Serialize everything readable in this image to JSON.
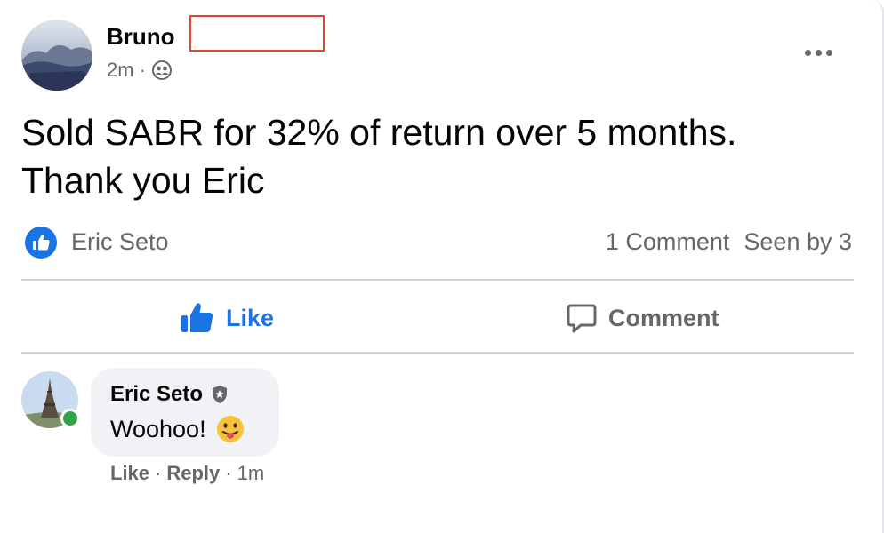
{
  "post": {
    "author": "Bruno",
    "time": "2m",
    "separator": "·",
    "audience_icon": "friends-icon",
    "more_icon": "more-options-icon",
    "text_line1": "Sold SABR for 32% of return over 5 months.",
    "text_line2": "Thank you Eric"
  },
  "reactions": {
    "icon": "like-reaction-icon",
    "reactor": "Eric Seto",
    "comment_count": "1 Comment",
    "seen_by": "Seen by 3"
  },
  "actions": {
    "like_label": "Like",
    "like_icon": "thumbs-up-icon",
    "comment_label": "Comment",
    "comment_icon": "speech-bubble-icon"
  },
  "comment": {
    "author": "Eric Seto",
    "badge_icon": "verified-shield-icon",
    "text": "Woohoo!",
    "emoji": "😛",
    "like_label": "Like",
    "reply_label": "Reply",
    "separator": "·",
    "time": "1m",
    "online": true
  },
  "colors": {
    "accent": "#1b74e4",
    "secondary_text": "#65676b",
    "bubble_bg": "#f0f2f5",
    "online": "#31a24c",
    "redaction_border": "#e0452d"
  }
}
